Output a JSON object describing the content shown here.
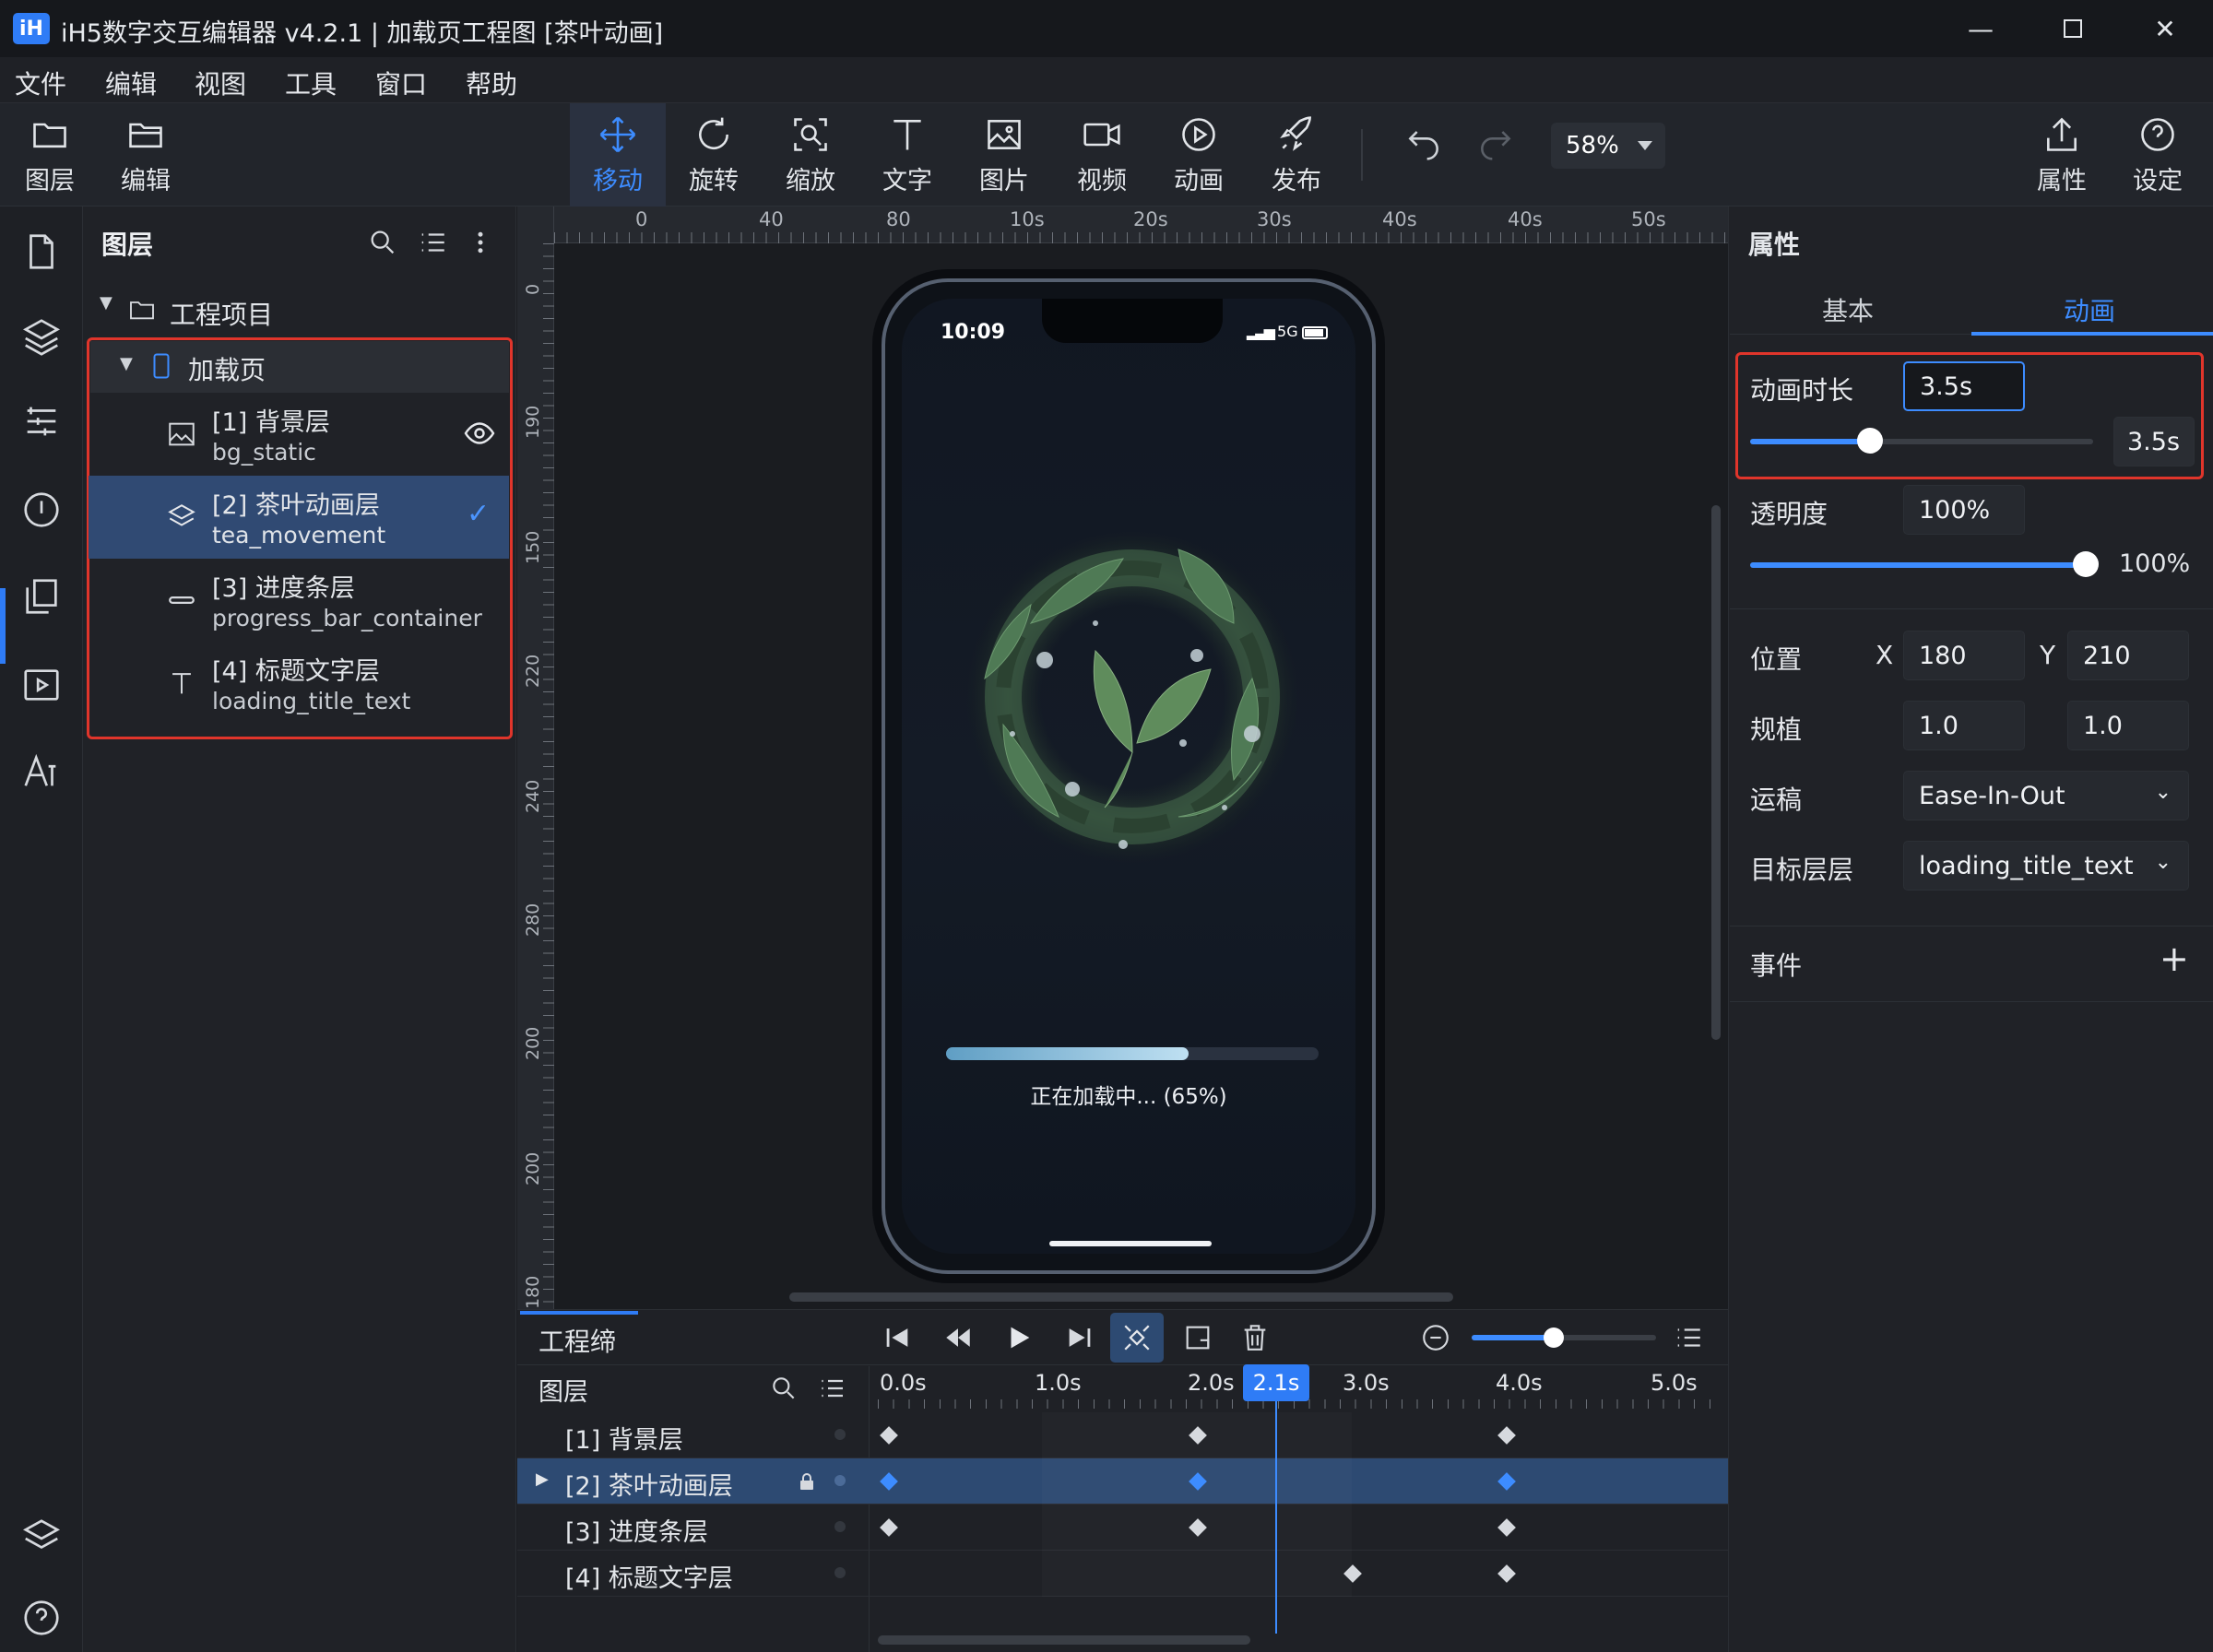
{
  "app": {
    "logo": "iH",
    "title": "iH5数字交互编辑器 v4.2.1 | 加载页工程图 [茶叶动画]"
  },
  "window_controls": [
    "minimize-icon",
    "maximize-icon",
    "close-icon"
  ],
  "menu": [
    "文件",
    "编辑",
    "视图",
    "工具",
    "窗口",
    "帮助"
  ],
  "toolbar": {
    "left": [
      {
        "label": "图层",
        "icon": "folder-icon"
      },
      {
        "label": "编辑",
        "icon": "folder-open-icon"
      }
    ],
    "tools": [
      {
        "label": "移动",
        "icon": "move-icon",
        "active": true
      },
      {
        "label": "旋转",
        "icon": "rotate-icon"
      },
      {
        "label": "缩放",
        "icon": "scale-icon"
      },
      {
        "label": "文字",
        "icon": "text-icon"
      },
      {
        "label": "图片",
        "icon": "image-icon"
      },
      {
        "label": "视频",
        "icon": "video-icon"
      },
      {
        "label": "动画",
        "icon": "play-circle-icon"
      },
      {
        "label": "发布",
        "icon": "rocket-icon"
      }
    ],
    "zoom": "58%",
    "right": [
      {
        "label": "属性",
        "icon": "share-icon"
      },
      {
        "label": "设定",
        "icon": "help-icon"
      }
    ]
  },
  "left_panel": {
    "title": "图层",
    "project": "工程项目",
    "page": "加载页",
    "layers": [
      {
        "name": "[1] 背景层",
        "id": "bg_static",
        "icon": "image-icon"
      },
      {
        "name": "[2] 茶叶动画层",
        "id": "tea_movement",
        "icon": "layers-icon",
        "selected": true
      },
      {
        "name": "[3] 进度条层",
        "id": "progress_bar_container",
        "icon": "bar-icon"
      },
      {
        "name": "[4] 标题文字层",
        "id": "loading_title_text",
        "icon": "text-icon"
      }
    ]
  },
  "rulers": {
    "top": [
      "0",
      "40",
      "80",
      "10s",
      "20s",
      "30s",
      "40s",
      "40s",
      "50s"
    ],
    "left": [
      "0",
      "190",
      "150",
      "220",
      "240",
      "280",
      "200",
      "200",
      "180"
    ]
  },
  "phone": {
    "time": "10:09",
    "network": "5G",
    "loading_text": "正在加载中... (65%)",
    "progress": 0.65
  },
  "timeline": {
    "title": "工程缔",
    "layers_label": "图层",
    "ticks": [
      "0.0s",
      "1.0s",
      "2.0s",
      "3.0s",
      "4.0s",
      "5.0s"
    ],
    "playhead": "2.1s",
    "rows": [
      "[1] 背景层",
      "[2] 茶叶动画层",
      "[3] 进度条层",
      "[4] 标题文字层"
    ],
    "keyframes": [
      [
        0,
        2,
        4
      ],
      [
        0,
        2,
        4
      ],
      [
        0,
        2,
        4
      ],
      [
        3,
        4
      ]
    ]
  },
  "properties": {
    "title": "属性",
    "tabs": [
      "基本",
      "动画"
    ],
    "duration_label": "动画时长",
    "duration": "3.5s",
    "duration_slider": "3.5s",
    "duration_fraction": 0.35,
    "opacity_label": "透明度",
    "opacity": "100%",
    "opacity_slider": "100%",
    "opacity_fraction": 1.0,
    "position_label": "位置",
    "x_label": "X",
    "x": "180",
    "y_label": "Y",
    "y": "210",
    "scale_label": "规植",
    "scale_x": "1.0",
    "scale_y": "1.0",
    "easing_label": "运稿",
    "easing": "Ease-In-Out",
    "target_label": "目标层层",
    "target": "loading_title_text",
    "events_label": "事件"
  },
  "colors": {
    "accent": "#3d8cff",
    "highlight": "#e0352b"
  }
}
